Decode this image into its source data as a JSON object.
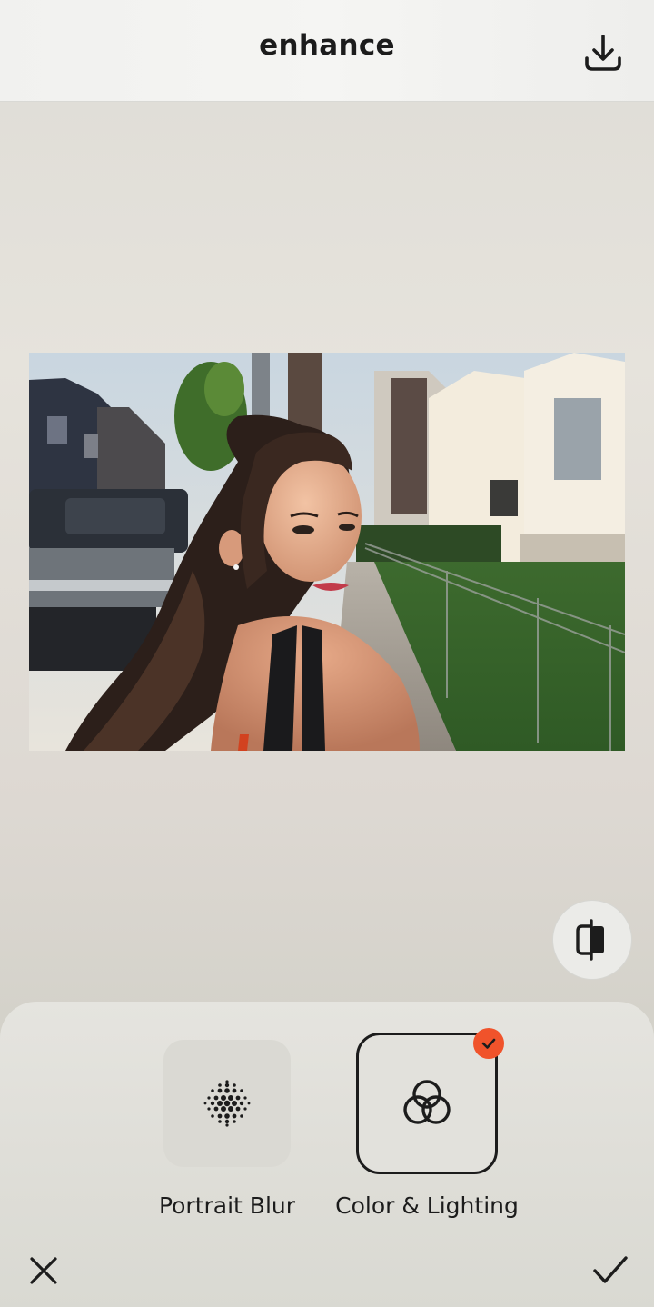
{
  "header": {
    "title": "enhance",
    "download_icon": "download-icon"
  },
  "photo": {
    "subject": "portrait-photo"
  },
  "compare": {
    "icon": "compare-split-icon"
  },
  "tools": [
    {
      "label": "Portrait Blur",
      "icon": "dot-grid-icon",
      "selected": false
    },
    {
      "label": "Color & Lighting",
      "icon": "interlocking-circles-icon",
      "selected": true
    }
  ],
  "footer": {
    "cancel_icon": "close-icon",
    "apply_icon": "checkmark-icon"
  },
  "colors": {
    "accent": "#f0532b",
    "text": "#1c1c1c",
    "selected_border": "#1c1c1c"
  }
}
